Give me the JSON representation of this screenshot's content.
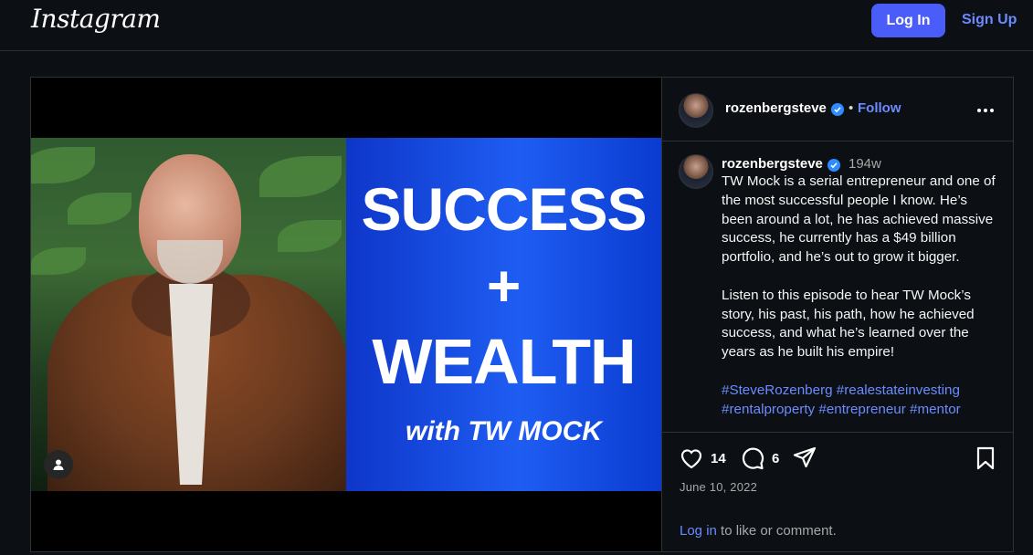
{
  "app": {
    "logo_text": "Instagram"
  },
  "topbar": {
    "login_label": "Log In",
    "signup_label": "Sign Up"
  },
  "media": {
    "title_line1": "SUCCESS",
    "plus": "+",
    "title_line2": "WEALTH",
    "subtitle": "with TW MOCK"
  },
  "post": {
    "username": "rozenbergsteve",
    "dot": "•",
    "follow_label": "Follow",
    "time_ago": "194w",
    "caption": "TW Mock is a serial entrepreneur and one of the most successful people I know. He’s been around a lot, he has achieved massive success, he currently has a $49 billion portfolio, and he’s out to grow it bigger.\n\nListen to this episode to hear TW Mock’s story, his past, his path, how he achieved success, and what he’s learned over the years as he built his empire!",
    "hashtags": "#SteveRozenberg #realestateinvesting #rentalproperty #entrepreneur #mentor",
    "likes": "14",
    "comments": "6",
    "date": "June 10, 2022",
    "login_link": "Log in",
    "login_rest": " to like or comment."
  },
  "icons": [
    "heart-icon",
    "comment-icon",
    "share-icon",
    "bookmark-icon",
    "more-options-icon",
    "verified-badge-icon",
    "tag-people-icon"
  ]
}
